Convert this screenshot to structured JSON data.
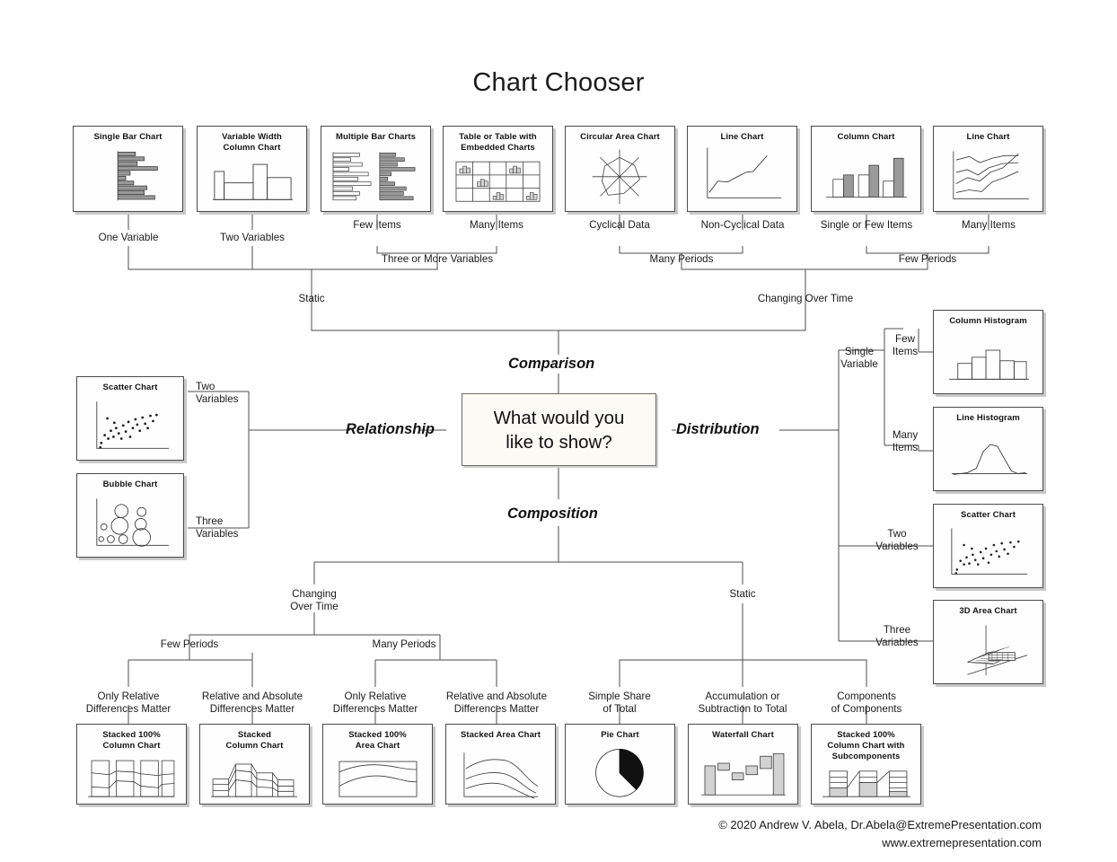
{
  "page": {
    "title": "Chart Chooser",
    "center_question_line1": "What would you",
    "center_question_line2": "like to show?"
  },
  "branches": {
    "comparison": "Comparison",
    "relationship": "Relationship",
    "distribution": "Distribution",
    "composition": "Composition"
  },
  "comparison": {
    "cards": [
      {
        "id": "single-bar-chart",
        "title": "Single Bar Chart",
        "title2": ""
      },
      {
        "id": "variable-width-column-chart",
        "title": "Variable Width",
        "title2": "Column Chart"
      },
      {
        "id": "multiple-bar-charts",
        "title": "Multiple Bar Charts",
        "title2": ""
      },
      {
        "id": "table-or-table-with-embedded-charts",
        "title": "Table or Table with",
        "title2": "Embedded Charts"
      },
      {
        "id": "circular-area-chart",
        "title": "Circular Area Chart",
        "title2": ""
      },
      {
        "id": "line-chart-non-cyclical",
        "title": "Line Chart",
        "title2": ""
      },
      {
        "id": "column-chart",
        "title": "Column Chart",
        "title2": ""
      },
      {
        "id": "line-chart-many-items",
        "title": "Line Chart",
        "title2": ""
      }
    ],
    "labels": {
      "one_variable": "One Variable",
      "two_variables": "Two Variables",
      "few_items": "Few Items",
      "many_items": "Many Items",
      "three_or_more_variables": "Three or More Variables",
      "cyclical_data": "Cyclical Data",
      "non_cyclical_data": "Non-Cyclical Data",
      "single_or_few_items": "Single or Few Items",
      "many_items_2": "Many Items",
      "many_periods": "Many Periods",
      "few_periods": "Few Periods",
      "static": "Static",
      "changing_over_time": "Changing Over Time"
    }
  },
  "relationship": {
    "cards": [
      {
        "id": "scatter-chart-relationship",
        "title": "Scatter Chart",
        "title2": ""
      },
      {
        "id": "bubble-chart",
        "title": "Bubble Chart",
        "title2": ""
      }
    ],
    "labels": {
      "two_variables": "Two\nVariables",
      "three_variables": "Three\nVariables"
    }
  },
  "distribution": {
    "cards": [
      {
        "id": "column-histogram",
        "title": "Column Histogram",
        "title2": ""
      },
      {
        "id": "line-histogram",
        "title": "Line Histogram",
        "title2": ""
      },
      {
        "id": "scatter-chart-distribution",
        "title": "Scatter Chart",
        "title2": ""
      },
      {
        "id": "3d-area-chart",
        "title": "3D Area Chart",
        "title2": ""
      }
    ],
    "labels": {
      "single_variable": "Single\nVariable",
      "few_items": "Few\nItems",
      "many_items": "Many\nItems",
      "two_variables": "Two\nVariables",
      "three_variables": "Three\nVariables"
    }
  },
  "composition": {
    "cards": [
      {
        "id": "stacked-100-column-chart",
        "title": "Stacked 100%",
        "title2": "Column Chart"
      },
      {
        "id": "stacked-column-chart",
        "title": "Stacked",
        "title2": "Column Chart"
      },
      {
        "id": "stacked-100-area-chart",
        "title": "Stacked 100%",
        "title2": "Area Chart"
      },
      {
        "id": "stacked-area-chart",
        "title": "Stacked Area Chart",
        "title2": ""
      },
      {
        "id": "pie-chart",
        "title": "Pie Chart",
        "title2": ""
      },
      {
        "id": "waterfall-chart",
        "title": "Waterfall Chart",
        "title2": ""
      },
      {
        "id": "stacked-100-column-chart-subcomponents",
        "title": "Stacked 100%",
        "title2": "Column Chart with",
        "title3": "Subcomponents"
      }
    ],
    "labels": {
      "changing_over_time": "Changing\nOver Time",
      "static": "Static",
      "few_periods": "Few Periods",
      "many_periods": "Many Periods",
      "only_relative_1": "Only Relative\nDifferences Matter",
      "relative_absolute_1": "Relative and Absolute\nDifferences Matter",
      "only_relative_2": "Only Relative\nDifferences Matter",
      "relative_absolute_2": "Relative and Absolute\nDifferences Matter",
      "simple_share": "Simple Share\nof Total",
      "accumulation": "Accumulation or\nSubtraction to Total",
      "components": "Components\nof Components"
    }
  },
  "footer": {
    "line1": "© 2020  Andrew V. Abela, Dr.Abela@ExtremePresentation.com",
    "line2": "www.extremepresentation.com"
  },
  "colors": {
    "background": "#ffffff",
    "card_border": "#4a4a4a",
    "card_shadow": "#c9c9c9",
    "center_fill": "#fbfaf4",
    "connector": "#4d4d4d",
    "bar_gray": "#8c8c8c",
    "bar_light": "#d9d9d9",
    "text": "#1a1a1a"
  }
}
